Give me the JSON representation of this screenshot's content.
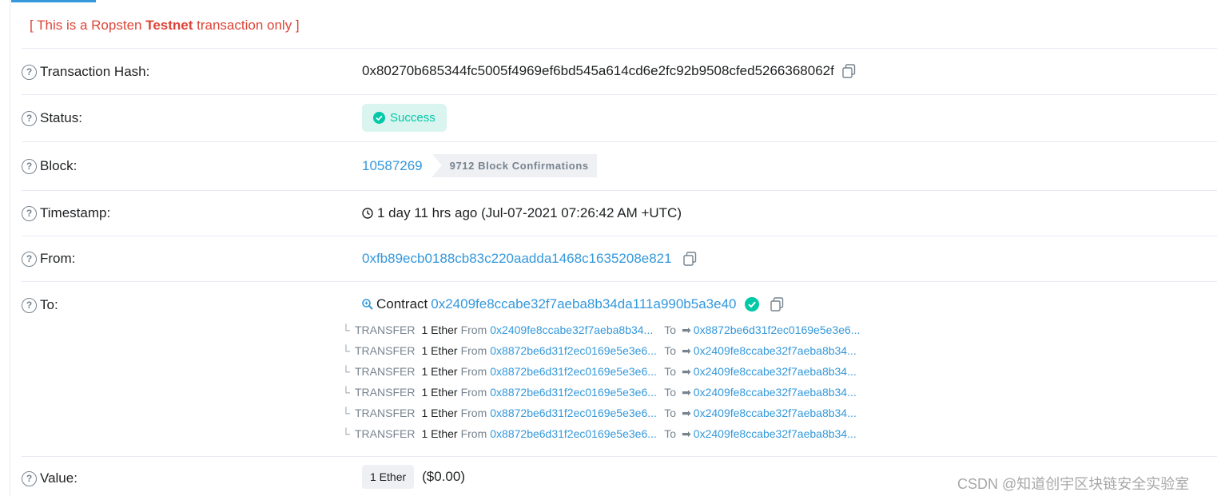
{
  "testnet_notice": {
    "prefix": "[ This is a Ropsten ",
    "bold": "Testnet",
    "suffix": " transaction only ]"
  },
  "labels": {
    "hash": "Transaction Hash:",
    "status": "Status:",
    "block": "Block:",
    "timestamp": "Timestamp:",
    "from": "From:",
    "to": "To:",
    "value": "Value:"
  },
  "help_glyph": "?",
  "transaction": {
    "hash": "0x80270b685344fc5005f4969ef6bd545a614cd6e2fc92b9508cfed5266368062f",
    "status": "Success",
    "block_number": "10587269",
    "confirmations": "9712 Block Confirmations",
    "timestamp": "1 day 11 hrs ago (Jul-07-2021 07:26:42 AM +UTC)",
    "from": "0xfb89ecb0188cb83c220aadda1468c1635208e821",
    "to_prefix": "Contract",
    "to_address": "0x2409fe8ccabe32f7aeba8b34da111a990b5a3e40",
    "value_amount": "1 Ether",
    "value_usd": "($0.00)"
  },
  "transfer_words": {
    "corner": "└",
    "type": "TRANSFER",
    "from": "From",
    "to": "To",
    "arrow": "➡"
  },
  "transfers": [
    {
      "amount": "1 Ether",
      "from": "0x2409fe8ccabe32f7aeba8b34...",
      "to": "0x8872be6d31f2ec0169e5e3e6..."
    },
    {
      "amount": "1 Ether",
      "from": "0x8872be6d31f2ec0169e5e3e6...",
      "to": "0x2409fe8ccabe32f7aeba8b34..."
    },
    {
      "amount": "1 Ether",
      "from": "0x8872be6d31f2ec0169e5e3e6...",
      "to": "0x2409fe8ccabe32f7aeba8b34..."
    },
    {
      "amount": "1 Ether",
      "from": "0x8872be6d31f2ec0169e5e3e6...",
      "to": "0x2409fe8ccabe32f7aeba8b34..."
    },
    {
      "amount": "1 Ether",
      "from": "0x8872be6d31f2ec0169e5e3e6...",
      "to": "0x2409fe8ccabe32f7aeba8b34..."
    },
    {
      "amount": "1 Ether",
      "from": "0x8872be6d31f2ec0169e5e3e6...",
      "to": "0x2409fe8ccabe32f7aeba8b34..."
    }
  ],
  "watermark": "CSDN @知道创宇区块链安全实验室",
  "icons": {
    "help": "question-circle-icon",
    "copy": "copy-icon",
    "success": "check-circle-icon",
    "clock": "clock-icon",
    "contract": "search-plus-icon",
    "verified": "verified-check-icon"
  },
  "colors": {
    "link": "#3498db",
    "success": "#00c9a7",
    "danger": "#de4437",
    "muted": "#77838f"
  }
}
